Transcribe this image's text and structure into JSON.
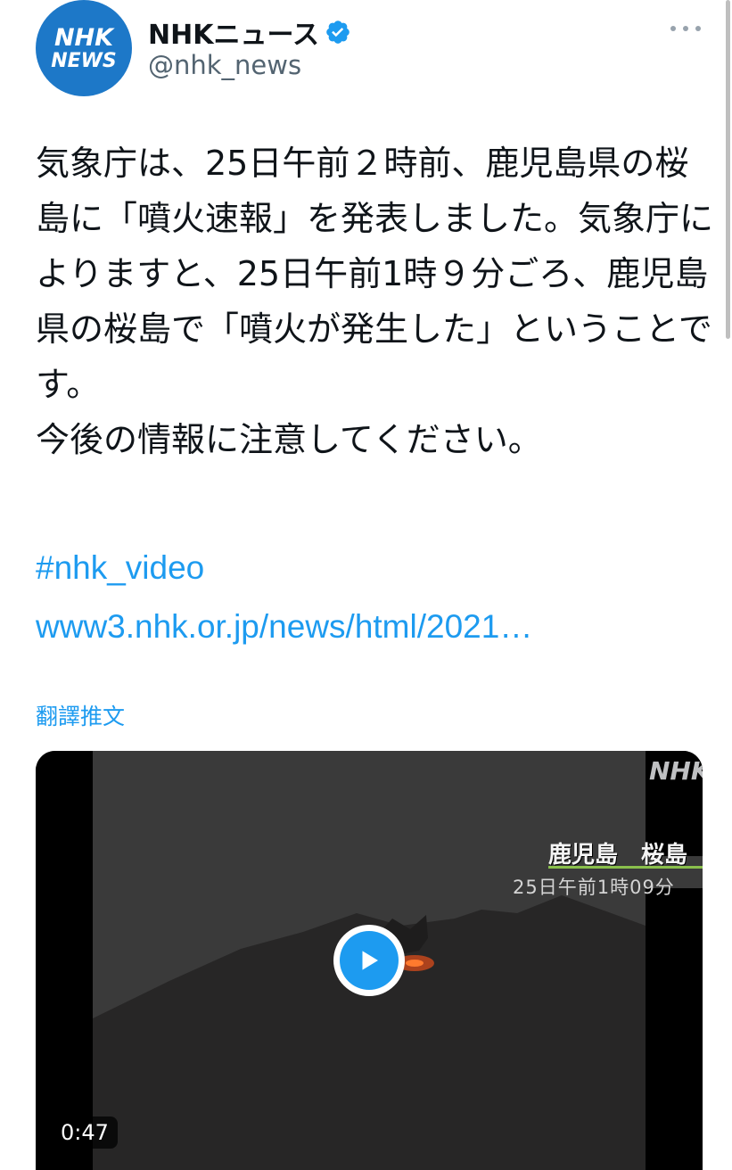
{
  "author": {
    "avatar_line1": "NHK",
    "avatar_line2": "NEWS",
    "display_name": "NHKニュース",
    "handle": "@nhk_news",
    "verified_icon": "verified-badge-icon",
    "more_icon": "more-dots-icon"
  },
  "tweet": {
    "paragraph1": "気象庁は、25日午前２時前、鹿児島県の桜島に「噴火速報」を発表しました。気象庁によりますと、25日午前1時９分ごろ、鹿児島県の桜島で「噴火が発生した」ということです。",
    "paragraph2": "今後の情報に注意してください。",
    "hashtag": "#nhk_video",
    "url": "www3.nhk.or.jp/news/html/2021…",
    "translate_label": "翻譯推文"
  },
  "media": {
    "duration": "0:47",
    "play_icon": "play-icon",
    "overlay_logo": "NHK",
    "overlay_location": "鹿児島　桜島",
    "overlay_time": "25日午前1時09分"
  },
  "colors": {
    "link": "#1d9bf0",
    "avatar_bg": "#1d78c8",
    "text": "#0f1419",
    "secondary_text": "#536471"
  }
}
